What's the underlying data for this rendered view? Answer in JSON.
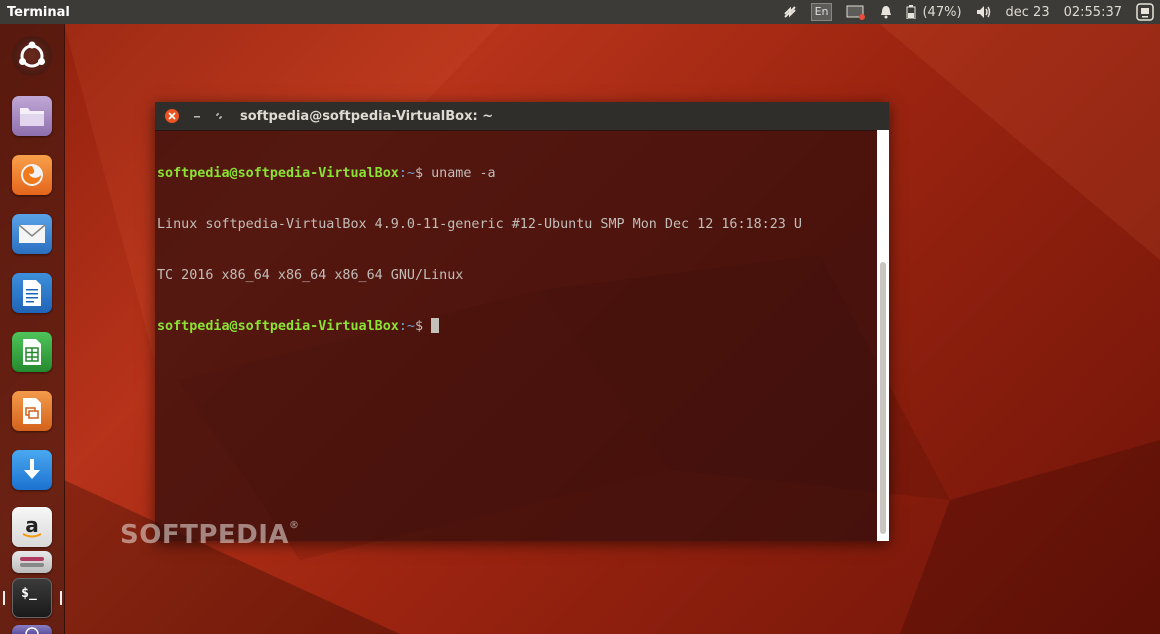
{
  "top_panel": {
    "app_title": "Terminal",
    "keyboard_layout": "En",
    "battery": "(47%)",
    "date": "dec 23",
    "time": "02:55:37",
    "icons": [
      "network-icon",
      "keyboard-icon",
      "display-icon",
      "notification-bell-icon",
      "battery-icon",
      "volume-icon",
      "system-menu-icon"
    ]
  },
  "launcher": {
    "items": [
      {
        "name": "ubuntu-dash",
        "icon": "ubuntu-logo-icon"
      },
      {
        "name": "files",
        "icon": "folder-icon"
      },
      {
        "name": "firefox",
        "icon": "firefox-icon"
      },
      {
        "name": "thunderbird",
        "icon": "mail-icon"
      },
      {
        "name": "writer",
        "icon": "document-icon"
      },
      {
        "name": "calc",
        "icon": "spreadsheet-icon"
      },
      {
        "name": "impress",
        "icon": "presentation-icon"
      },
      {
        "name": "software-updater",
        "icon": "download-icon"
      },
      {
        "name": "amazon",
        "icon": "amazon-icon"
      },
      {
        "name": "settings",
        "icon": "toggle-icon"
      },
      {
        "name": "terminal",
        "icon": "terminal-icon",
        "glyph": "$_"
      },
      {
        "name": "trash",
        "icon": "trash-icon"
      }
    ]
  },
  "window": {
    "title": "softpedia@softpedia-VirtualBox: ~"
  },
  "terminal": {
    "prompt_user": "softpedia@softpedia-VirtualBox",
    "prompt_path": ":~",
    "prompt_symbol": "$ ",
    "command": "uname -a",
    "output_line1": "Linux softpedia-VirtualBox 4.9.0-11-generic #12-Ubuntu SMP Mon Dec 12 16:18:23 U",
    "output_line2": "TC 2016 x86_64 x86_64 x86_64 GNU/Linux"
  },
  "watermark": {
    "text": "SOFTPEDIA",
    "mark": "®"
  },
  "colors": {
    "prompt_user": "#8ae234",
    "prompt_path": "#729fcf",
    "panel": "#3c3b37",
    "close_button": "#e95420"
  }
}
